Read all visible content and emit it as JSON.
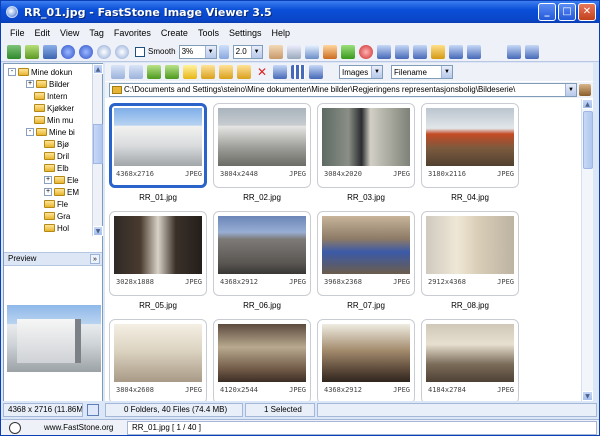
{
  "window": {
    "title": "RR_01.jpg  -  FastStone Image Viewer 3.5"
  },
  "menu": [
    "File",
    "Edit",
    "View",
    "Tag",
    "Favorites",
    "Create",
    "Tools",
    "Settings",
    "Help"
  ],
  "toolbar": {
    "smooth_label": "Smooth",
    "zoom_value": "3%",
    "ratio_value": "2.0"
  },
  "browser": {
    "filter_value": "Images",
    "sort_value": "Filename",
    "path": "C:\\Documents and Settings\\steino\\Mine dokumenter\\Mine bilder\\Regjeringens representasjonsbolig\\Bildeserie\\"
  },
  "tree": {
    "items": [
      {
        "label": "Mine dokun",
        "expander": "-"
      },
      {
        "label": "Bilder",
        "expander": "+"
      },
      {
        "label": "Intern",
        "expander": ""
      },
      {
        "label": "Kjøkker",
        "expander": ""
      },
      {
        "label": "Min mu",
        "expander": ""
      },
      {
        "label": "Mine bi",
        "expander": "-"
      },
      {
        "label": "Bjø",
        "expander": ""
      },
      {
        "label": "Dril",
        "expander": ""
      },
      {
        "label": "Elb",
        "expander": ""
      },
      {
        "label": "Ele",
        "expander": "+"
      },
      {
        "label": "EM",
        "expander": "+"
      },
      {
        "label": "Fle",
        "expander": ""
      },
      {
        "label": "Gra",
        "expander": ""
      },
      {
        "label": "Hol",
        "expander": ""
      }
    ]
  },
  "preview": {
    "label": "Preview",
    "toggle": "»"
  },
  "thumbnails": [
    {
      "file": "RR_01.jpg",
      "dims": "4368x2716",
      "fmt": "JPEG"
    },
    {
      "file": "RR_02.jpg",
      "dims": "3804x2448",
      "fmt": "JPEG"
    },
    {
      "file": "RR_03.jpg",
      "dims": "3084x2020",
      "fmt": "JPEG"
    },
    {
      "file": "RR_04.jpg",
      "dims": "3180x2116",
      "fmt": "JPEG"
    },
    {
      "file": "RR_05.jpg",
      "dims": "3028x1888",
      "fmt": "JPEG"
    },
    {
      "file": "RR_06.jpg",
      "dims": "4368x2912",
      "fmt": "JPEG"
    },
    {
      "file": "RR_07.jpg",
      "dims": "3968x2368",
      "fmt": "JPEG"
    },
    {
      "file": "RR_08.jpg",
      "dims": "2912x4368",
      "fmt": "JPEG"
    },
    {
      "file": "",
      "dims": "3804x2608",
      "fmt": "JPEG"
    },
    {
      "file": "",
      "dims": "4120x2544",
      "fmt": "JPEG"
    },
    {
      "file": "",
      "dims": "4368x2912",
      "fmt": "JPEG"
    },
    {
      "file": "",
      "dims": "4184x2784",
      "fmt": "JPEG"
    }
  ],
  "status": {
    "image_info": "4368 x 2716 (11.86M",
    "folder_info": "0 Folders, 40 Files (74.4 MB)",
    "selected": "1 Selected"
  },
  "bottom": {
    "website": "www.FastStone.org",
    "current_file": "RR_01.jpg [ 1 / 40 ]"
  }
}
